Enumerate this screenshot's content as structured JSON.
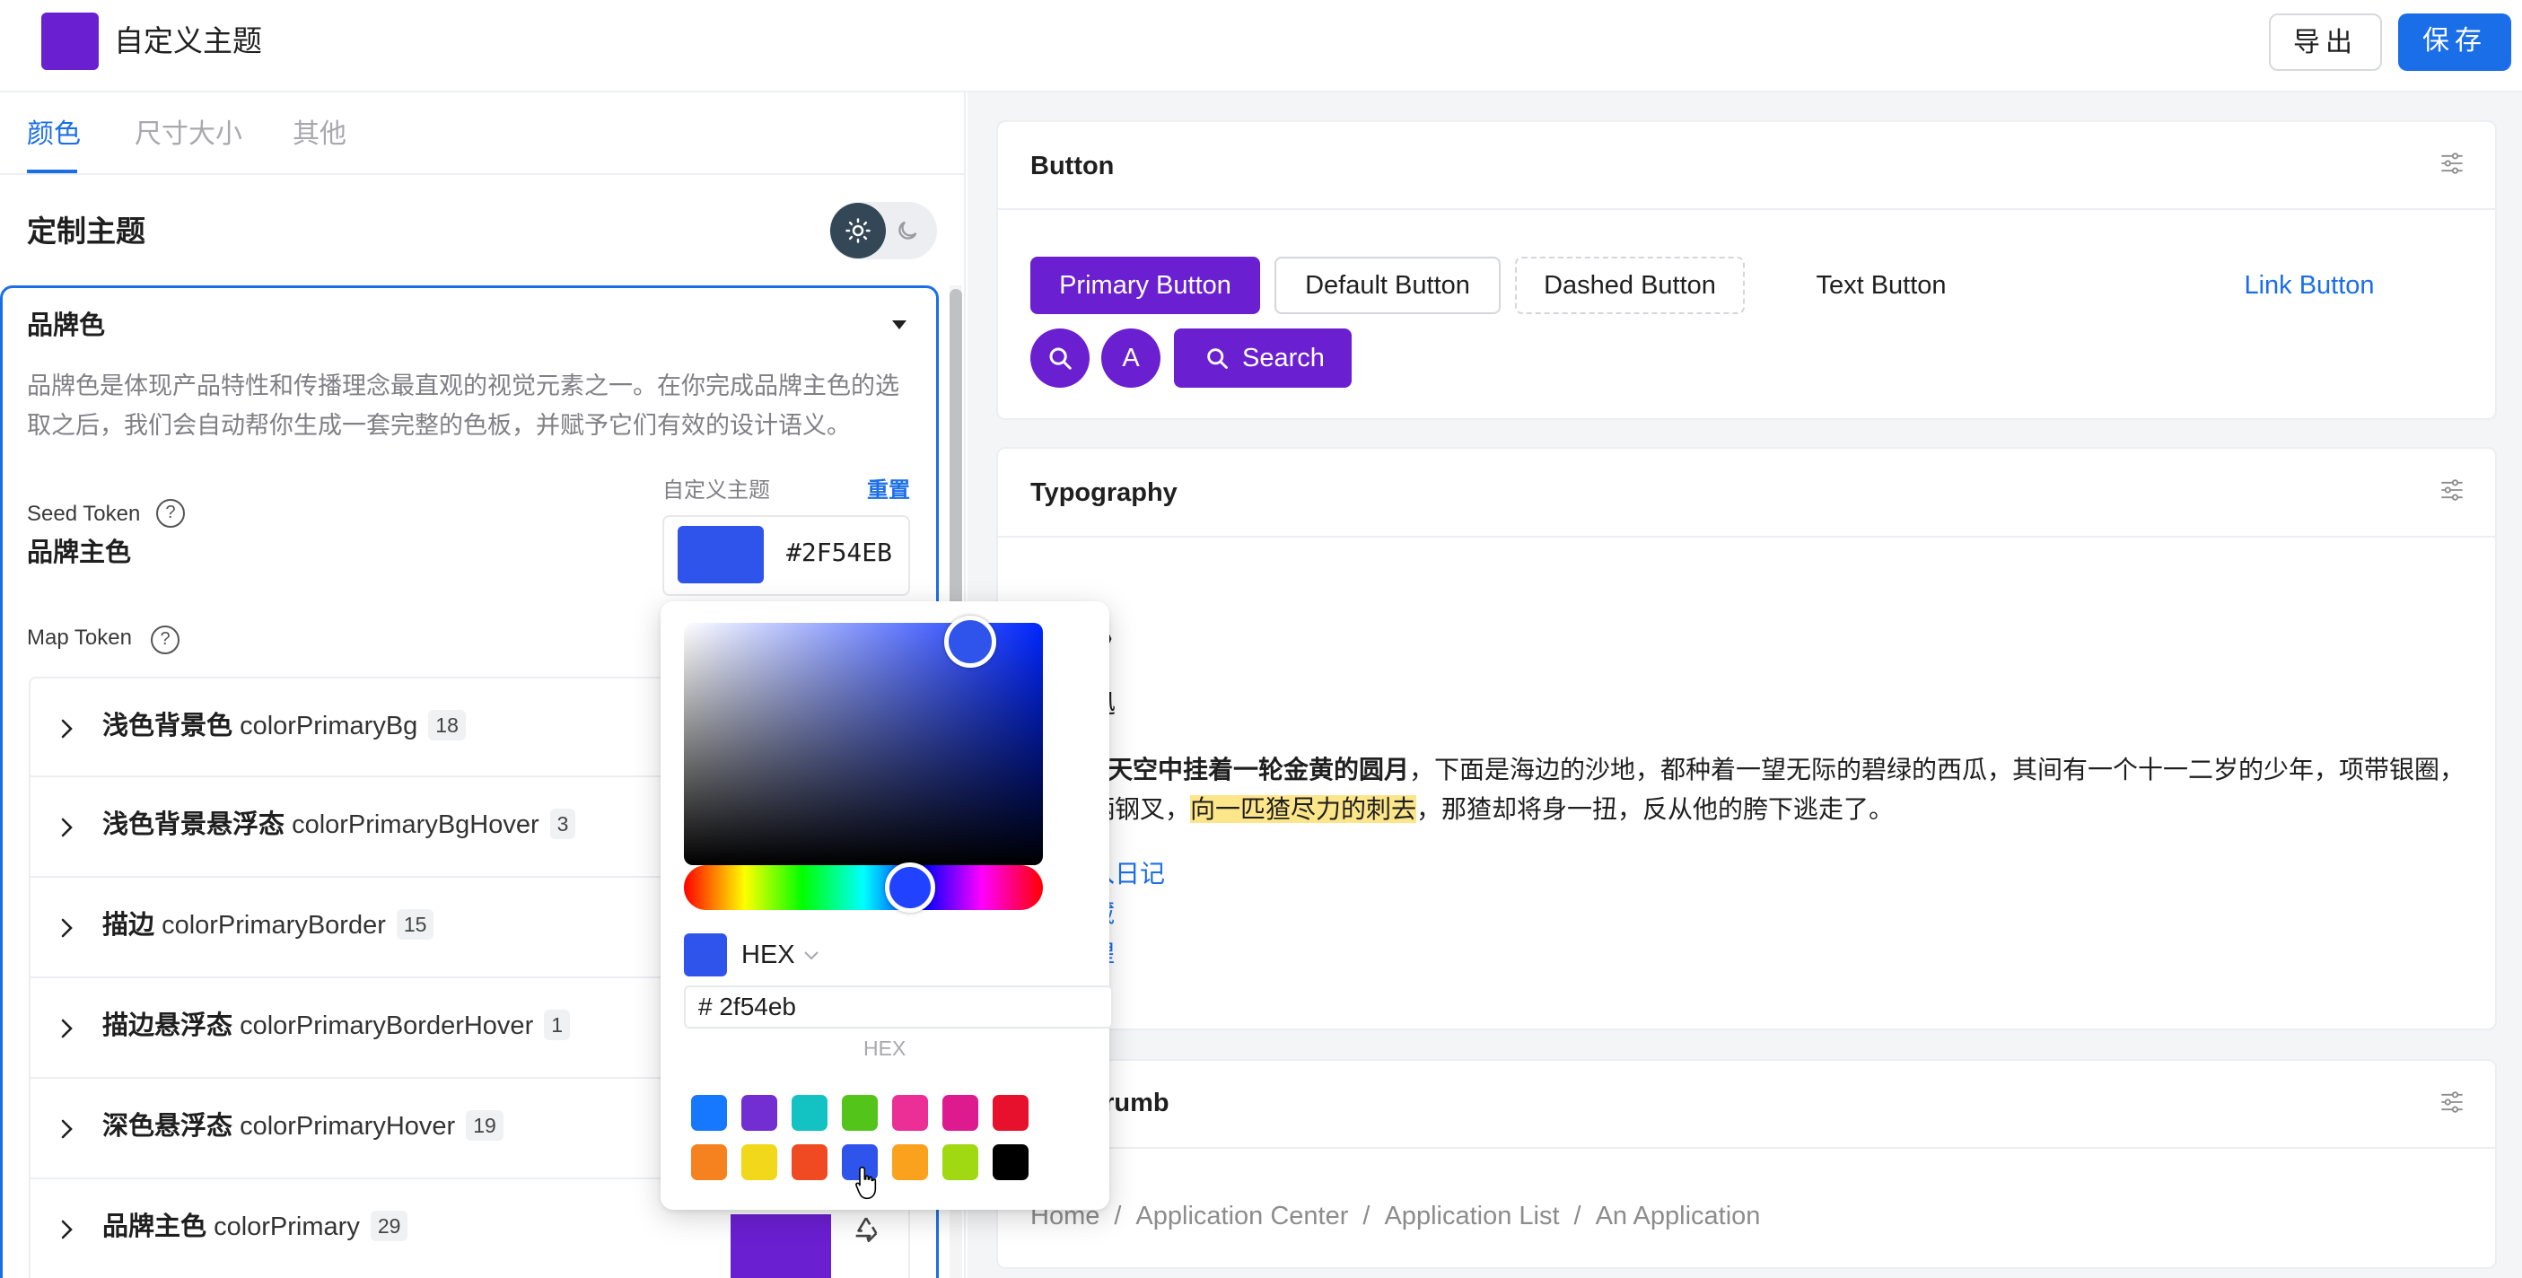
{
  "header": {
    "title": "自定义主题",
    "export_label": "导出",
    "save_label": "保存",
    "logo_color": "#6a1fd0"
  },
  "left_tabs": [
    {
      "label": "颜色",
      "active": true
    },
    {
      "label": "尺寸大小",
      "active": false
    },
    {
      "label": "其他",
      "active": false
    }
  ],
  "customize": {
    "title": "定制主题",
    "theme_mode": "light"
  },
  "brand_card": {
    "title": "品牌色",
    "description": "品牌色是体现产品特性和传播理念最直观的视觉元素之一。在你完成品牌主色的选取之后，我们会自动帮你生成一套完整的色板，并赋予它们有效的设计语义。",
    "seed_label": "Seed Token",
    "seed_name": "品牌主色",
    "custom_theme_label": "自定义主题",
    "reset_label": "重置",
    "seed_value": "#2F54EB",
    "map_label": "Map Token",
    "help_glyph": "?"
  },
  "map_tokens": [
    {
      "name": "浅色背景色",
      "key": "colorPrimaryBg",
      "count": "18"
    },
    {
      "name": "浅色背景悬浮态",
      "key": "colorPrimaryBgHover",
      "count": "3"
    },
    {
      "name": "描边",
      "key": "colorPrimaryBorder",
      "count": "15"
    },
    {
      "name": "描边悬浮态",
      "key": "colorPrimaryBorderHover",
      "count": "1"
    },
    {
      "name": "深色悬浮态",
      "key": "colorPrimaryHover",
      "count": "19"
    },
    {
      "name": "品牌主色",
      "key": "colorPrimary",
      "count": "29",
      "swatch": "#6a1fd0"
    }
  ],
  "color_picker": {
    "current_color": "#2f54eb",
    "mode": "HEX",
    "hex_value": "# 2f54eb",
    "hex_caption": "HEX",
    "presets": [
      "#1677ff",
      "#722ed1",
      "#13c2c2",
      "#52c41a",
      "#eb2f96",
      "#dd1a8e",
      "#e8112d",
      "#f5811f",
      "#f2d81b",
      "#f04a22",
      "#2f54eb",
      "#faa21e",
      "#a0d911",
      "#000000"
    ]
  },
  "button_card": {
    "title": "Button",
    "primary": "Primary Button",
    "default": "Default Button",
    "dashed": "Dashed Button",
    "text": "Text Button",
    "link": "Link Button",
    "circle_letter": "A",
    "search": "Search",
    "accent": "#6a1fd0"
  },
  "typography_card": {
    "title": "Typography",
    "heading": "乡》",
    "author": "迅",
    "p1_bold": "天空中挂着一轮金黄的圆月",
    "p1_rest": "，下面是海边的沙地，都种着一望无际的碧绿的西瓜，其间有一个十一二岁的少年，项带银圈，",
    "p2_pre": "柄钢叉，",
    "p2_mark": "向一匹猹尽力的刺去",
    "p2_post": "，那猹却将身一扭，反从他的胯下逃走了。",
    "links": [
      "入日记",
      "藏",
      "惶"
    ]
  },
  "breadcrumb_card": {
    "title": "crumb",
    "items": [
      "Home",
      "Application Center",
      "Application List",
      "An Application"
    ],
    "separator": "/"
  },
  "colors": {
    "accent": "#1a6ee8",
    "brand": "#6a1fd0",
    "seed": "#2f54eb",
    "highlight": "#fde68a"
  }
}
